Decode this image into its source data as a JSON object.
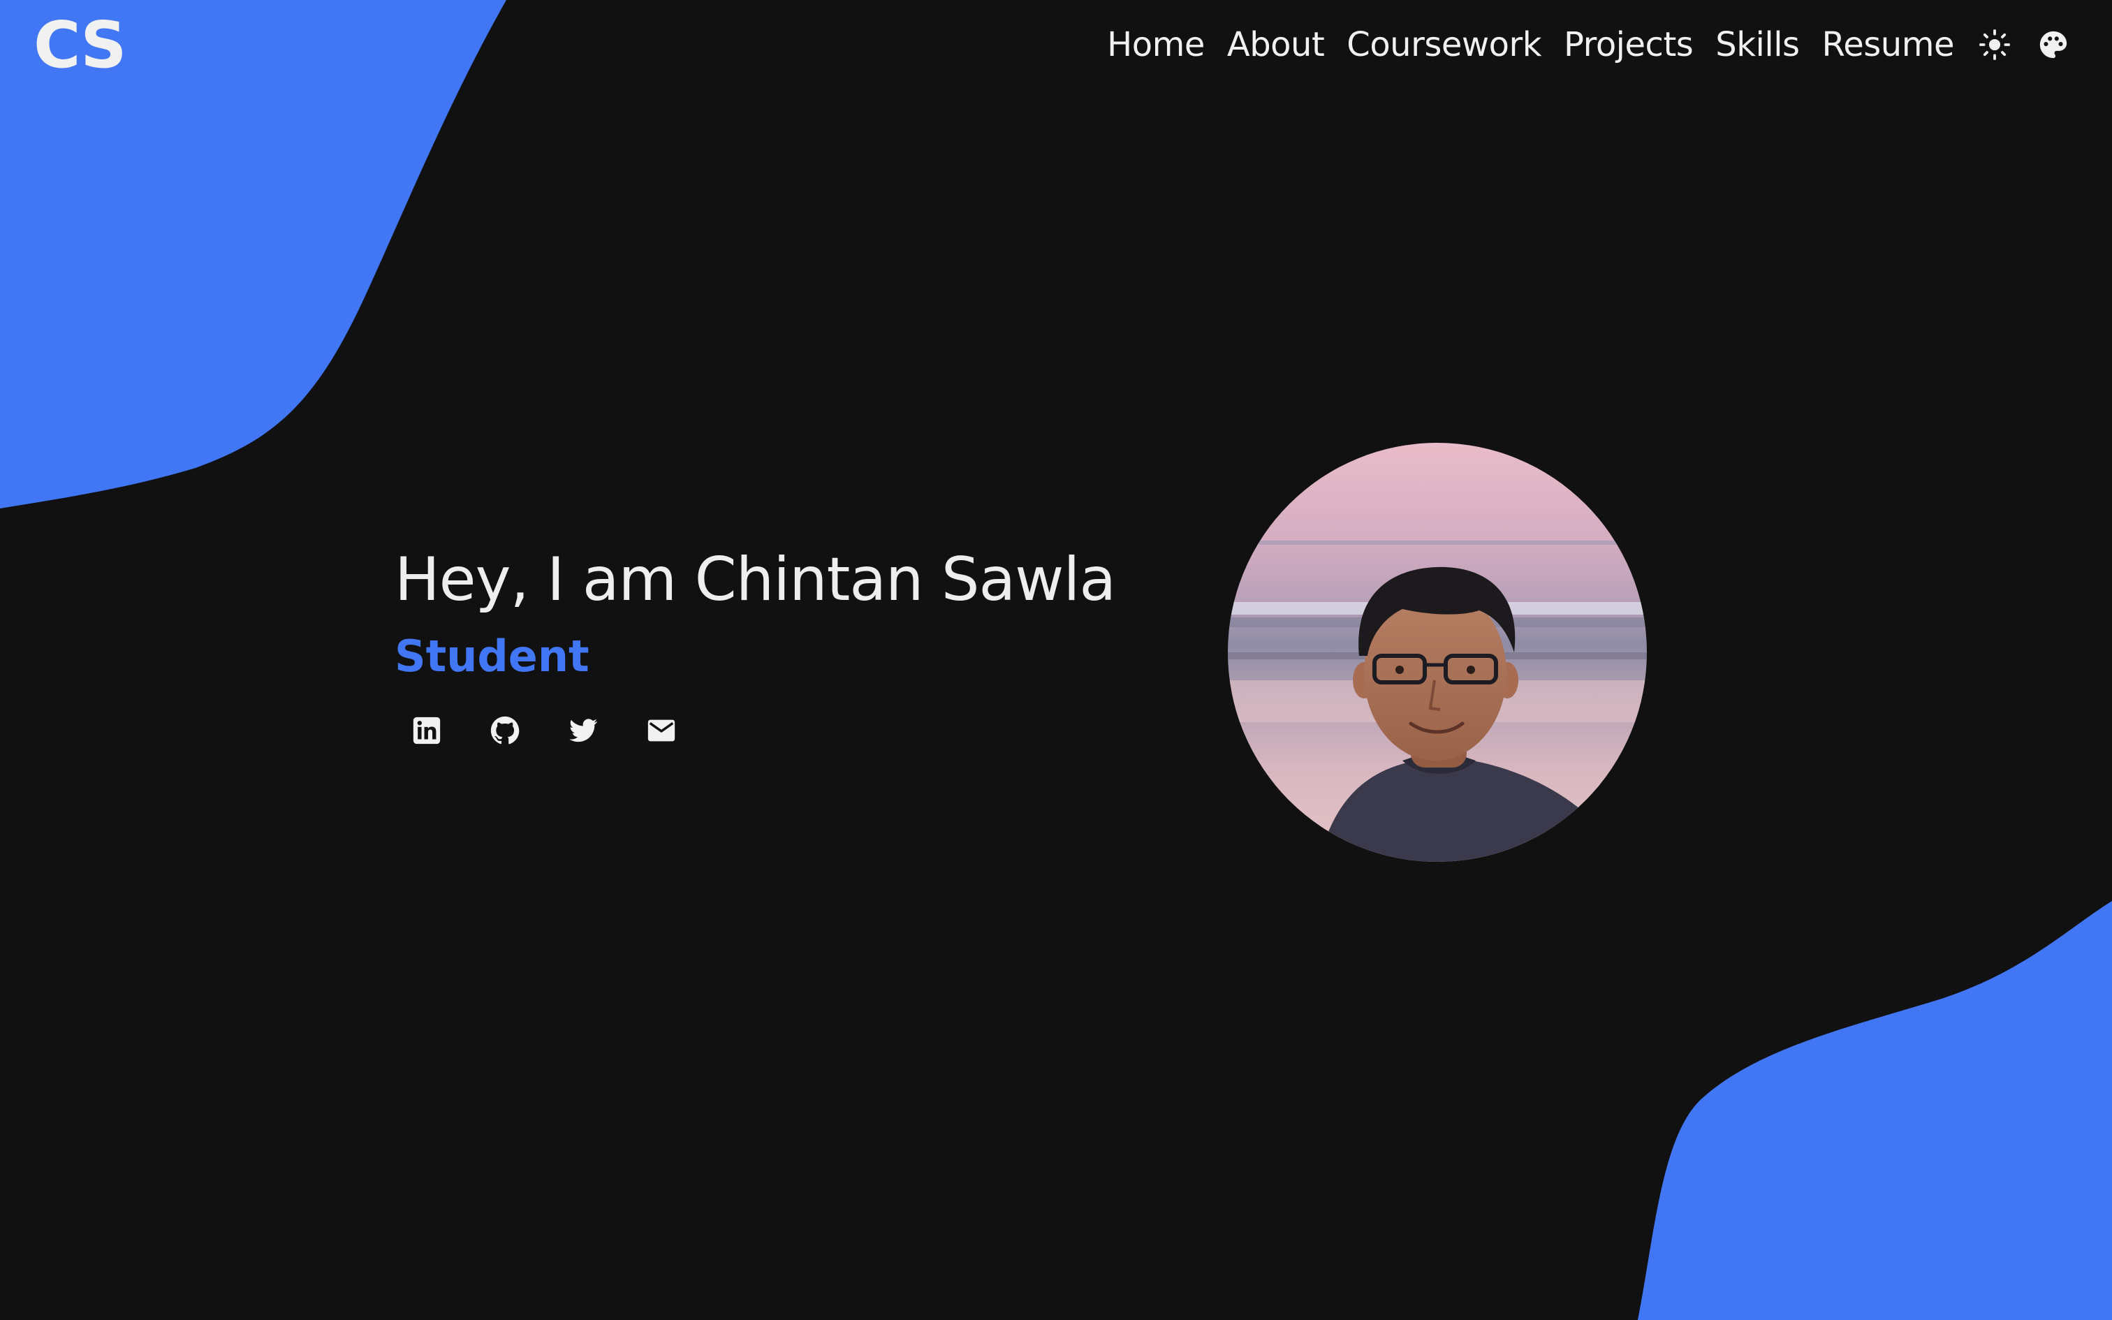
{
  "brand": {
    "logo": "CS",
    "accent_color": "#4176f5",
    "background_color": "#111111"
  },
  "nav": {
    "items": [
      {
        "label": "Home"
      },
      {
        "label": "About"
      },
      {
        "label": "Coursework"
      },
      {
        "label": "Projects"
      },
      {
        "label": "Skills"
      },
      {
        "label": "Resume"
      }
    ],
    "theme_toggle_icon": "sun-icon",
    "palette_icon": "palette-icon"
  },
  "hero": {
    "greeting": "Hey, I am Chintan Sawla",
    "role": "Student",
    "socials": [
      {
        "icon": "linkedin-icon"
      },
      {
        "icon": "github-icon"
      },
      {
        "icon": "twitter-icon"
      },
      {
        "icon": "email-icon"
      }
    ],
    "avatar": "profile-photo"
  }
}
